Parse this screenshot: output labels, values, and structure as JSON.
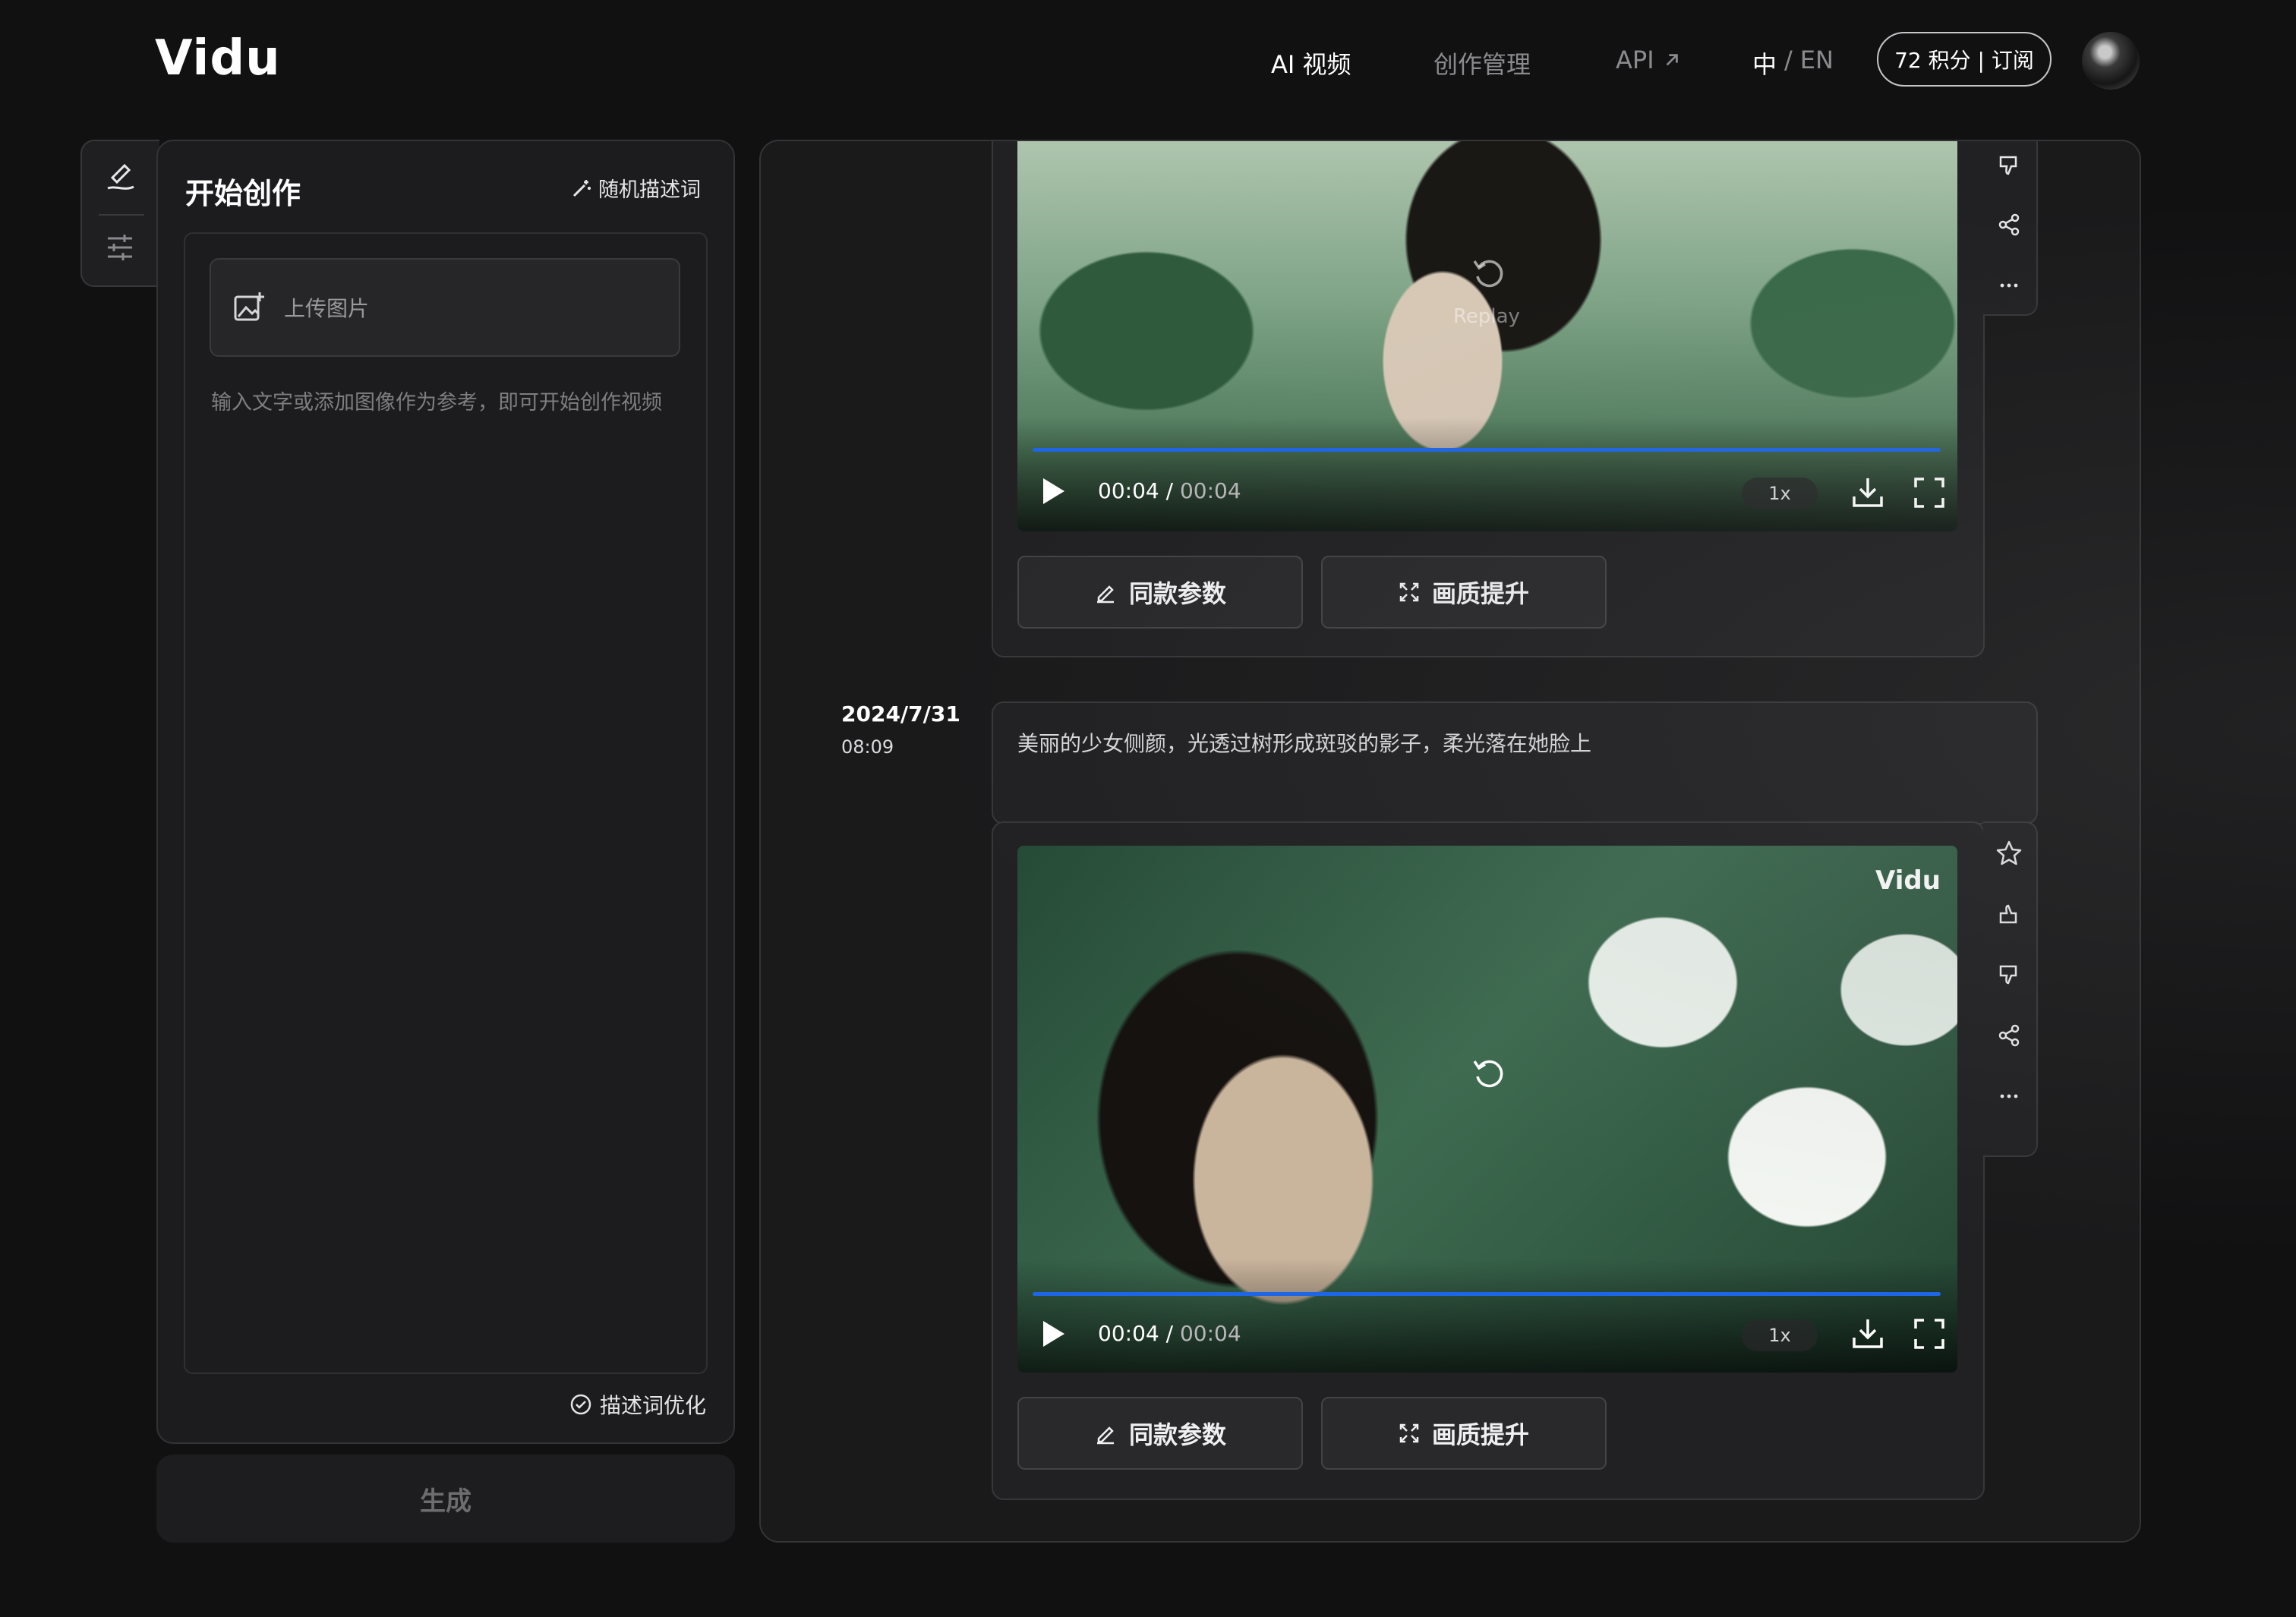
{
  "header": {
    "logo": "Vidu",
    "nav": {
      "ai_video": "AI 视频",
      "creation_management": "创作管理",
      "api": "API",
      "lang_zh": "中",
      "lang_sep": "/",
      "lang_en": "EN"
    },
    "credits_label": "72 积分 | 订阅"
  },
  "left_panel": {
    "title": "开始创作",
    "random_prompt_label": "随机描述词",
    "upload_label": "上传图片",
    "hint": "输入文字或添加图像作为参考，即可开始创作视频",
    "optimize_label": "描述词优化",
    "generate_label": "生成"
  },
  "results": [
    {
      "player": {
        "current_time": "00:04",
        "separator": "/",
        "duration": "00:04",
        "speed": "1x",
        "progress": 1.0,
        "overlay_label": "Replay"
      },
      "buttons": {
        "same_params": "同款参数",
        "upscale": "画质提升"
      }
    },
    {
      "date": "2024/7/31",
      "time": "08:09",
      "prompt": "美丽的少女侧颜，光透过树形成斑驳的影子，柔光落在她脸上",
      "watermark": "Vidu",
      "player": {
        "current_time": "00:04",
        "separator": "/",
        "duration": "00:04",
        "speed": "1x",
        "progress": 1.0
      },
      "buttons": {
        "same_params": "同款参数",
        "upscale": "画质提升"
      }
    }
  ],
  "icons": {
    "tool_tab": [
      "brush-icon",
      "sliders-icon"
    ],
    "side_actions": [
      "star-icon",
      "thumbs-up-icon",
      "thumbs-down-icon",
      "share-icon",
      "more-icon"
    ],
    "player": [
      "play-icon",
      "download-icon",
      "fullscreen-icon",
      "replay-icon"
    ]
  },
  "colors": {
    "accent_progress": "#1f66e6",
    "background": "#111112",
    "panel": "#1c1c1e"
  }
}
